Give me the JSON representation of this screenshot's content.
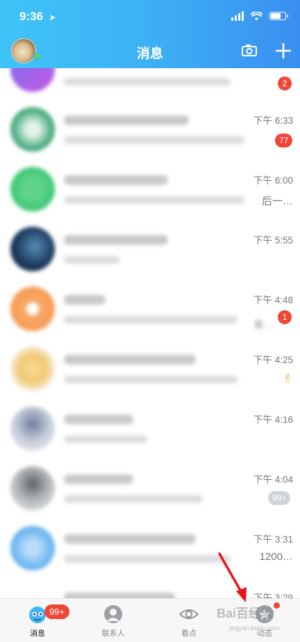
{
  "status_bar": {
    "time": "9:36"
  },
  "header": {
    "title": "消息"
  },
  "conversations": [
    {
      "time": "",
      "badge": "2"
    },
    {
      "time": "下午 6:33",
      "badge": "77"
    },
    {
      "time": "下午 6:00",
      "side": "后一…"
    },
    {
      "time": "下午 5:55"
    },
    {
      "time": "下午 4:48",
      "badge": "1",
      "side": "态…"
    },
    {
      "time": "下午 4:25",
      "side": "✌"
    },
    {
      "time": "下午 4:16"
    },
    {
      "time": "下午 4:04",
      "badge": "99+"
    },
    {
      "time": "下午 3:31",
      "side": "1200…"
    },
    {
      "time": "下午 3:29"
    }
  ],
  "tabbar": {
    "messages": "消息",
    "contacts": "联系人",
    "watch": "看点",
    "moments": "动态",
    "messages_badge": "99+"
  },
  "watermark": {
    "text": "Bai百经验",
    "sub": "jingyan.baidu.com"
  },
  "colors": {
    "header_start": "#3fc4f7",
    "header_end": "#3a8ff0",
    "badge": "#f04638",
    "annotation_arrow": "#e8141a"
  }
}
